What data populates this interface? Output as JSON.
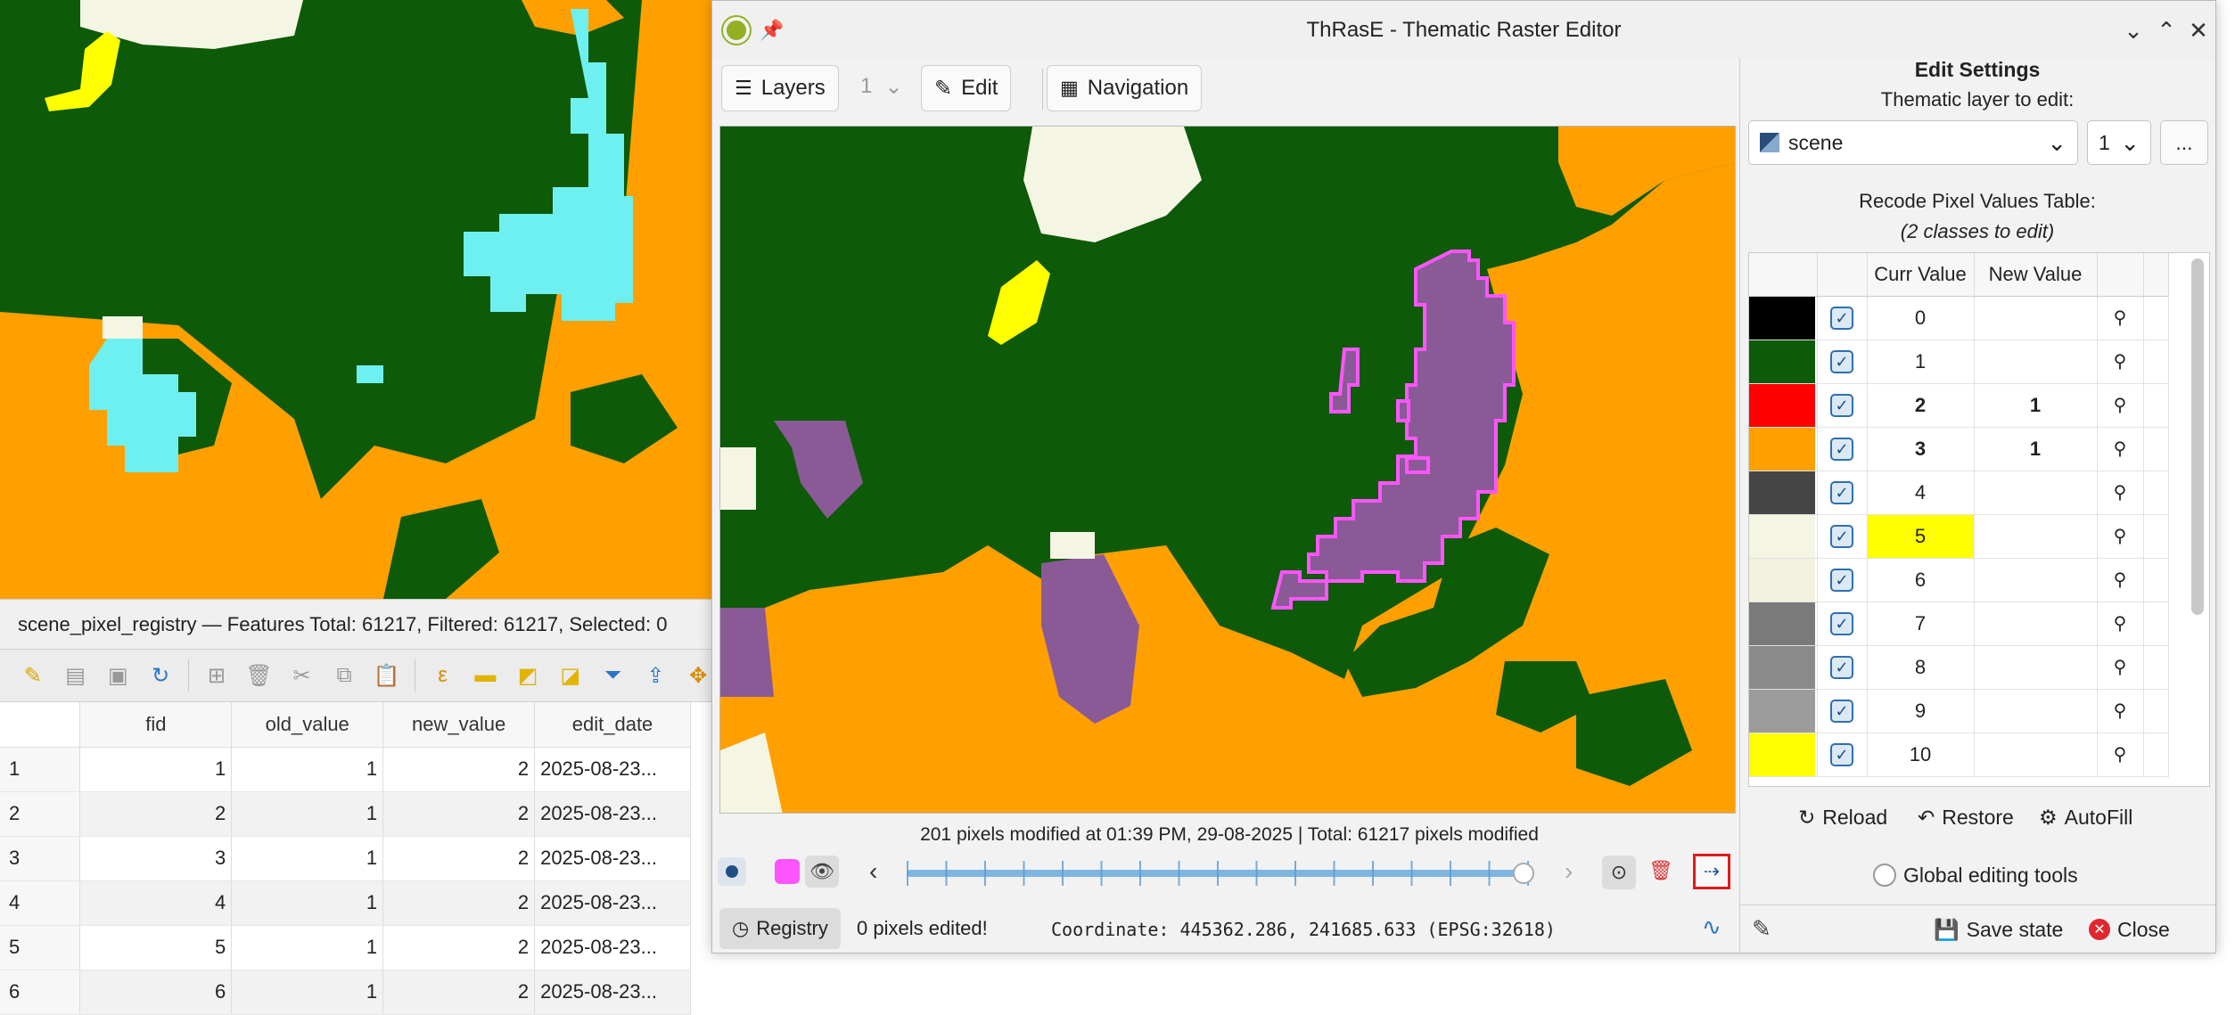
{
  "background": {
    "layer_status": "scene_pixel_registry — Features Total: 61217, Filtered: 61217, Selected: 0",
    "toolbar_icons": [
      "pencil-icon",
      "edit-icon",
      "save-icon",
      "refresh-icon",
      "add-row-icon",
      "delete-icon",
      "cut-icon",
      "copy-icon",
      "paste-icon",
      "expression-icon",
      "select-all-icon",
      "invert-select-icon",
      "deselect-icon",
      "filter-icon",
      "move-top-icon",
      "pan-icon"
    ],
    "table": {
      "columns": [
        "fid",
        "old_value",
        "new_value",
        "edit_date"
      ],
      "rows": [
        {
          "n": "1",
          "fid": "1",
          "old": "1",
          "new": "2",
          "date": "2025-08-23..."
        },
        {
          "n": "2",
          "fid": "2",
          "old": "1",
          "new": "2",
          "date": "2025-08-23..."
        },
        {
          "n": "3",
          "fid": "3",
          "old": "1",
          "new": "2",
          "date": "2025-08-23..."
        },
        {
          "n": "4",
          "fid": "4",
          "old": "1",
          "new": "2",
          "date": "2025-08-23..."
        },
        {
          "n": "5",
          "fid": "5",
          "old": "1",
          "new": "2",
          "date": "2025-08-23..."
        },
        {
          "n": "6",
          "fid": "6",
          "old": "1",
          "new": "2",
          "date": "2025-08-23..."
        }
      ]
    }
  },
  "window": {
    "title": "ThRasE - Thematic Raster Editor",
    "toolbar": {
      "layers_label": "Layers",
      "layers_count": "1",
      "edit_label": "Edit",
      "navigation_label": "Navigation"
    },
    "status": "201 pixels modified at 01:39 PM, 29-08-2025 | Total: 61217 pixels modified",
    "bottom": {
      "registry_label": "Registry",
      "pixels_edited": "0 pixels edited!",
      "coordinate": "Coordinate: 445362.286, 241685.633 (EPSG:32618)"
    },
    "edit_settings": {
      "heading": "Edit Settings",
      "layer_label": "Thematic layer to edit:",
      "layer_value": "scene",
      "band_value": "1",
      "browse_label": "...",
      "table_title": "Recode Pixel Values Table:",
      "table_subtitle": "(2 classes to edit)",
      "columns": [
        "Curr Value",
        "New Value"
      ],
      "rows": [
        {
          "color": "#000000",
          "curr": "0",
          "new": "",
          "bold": false,
          "highlight": false
        },
        {
          "color": "#0d5a08",
          "curr": "1",
          "new": "",
          "bold": false,
          "highlight": false
        },
        {
          "color": "#ff0000",
          "curr": "2",
          "new": "1",
          "bold": true,
          "highlight": false
        },
        {
          "color": "#ffa000",
          "curr": "3",
          "new": "1",
          "bold": true,
          "highlight": false
        },
        {
          "color": "#454545",
          "curr": "4",
          "new": "",
          "bold": false,
          "highlight": false
        },
        {
          "color": "#f5f5e4",
          "curr": "5",
          "new": "",
          "bold": false,
          "highlight": true
        },
        {
          "color": "#f3f2df",
          "curr": "6",
          "new": "",
          "bold": false,
          "highlight": false
        },
        {
          "color": "#7a7a7a",
          "curr": "7",
          "new": "",
          "bold": false,
          "highlight": false
        },
        {
          "color": "#8a8a8a",
          "curr": "8",
          "new": "",
          "bold": false,
          "highlight": false
        },
        {
          "color": "#9c9c9c",
          "curr": "9",
          "new": "",
          "bold": false,
          "highlight": false
        },
        {
          "color": "#ffff00",
          "curr": "10",
          "new": "",
          "bold": false,
          "highlight": false
        }
      ],
      "reload_label": "Reload",
      "restore_label": "Restore",
      "autofill_label": "AutoFill",
      "global_tools_label": "Global editing tools",
      "save_state_label": "Save state",
      "close_label": "Close"
    }
  }
}
